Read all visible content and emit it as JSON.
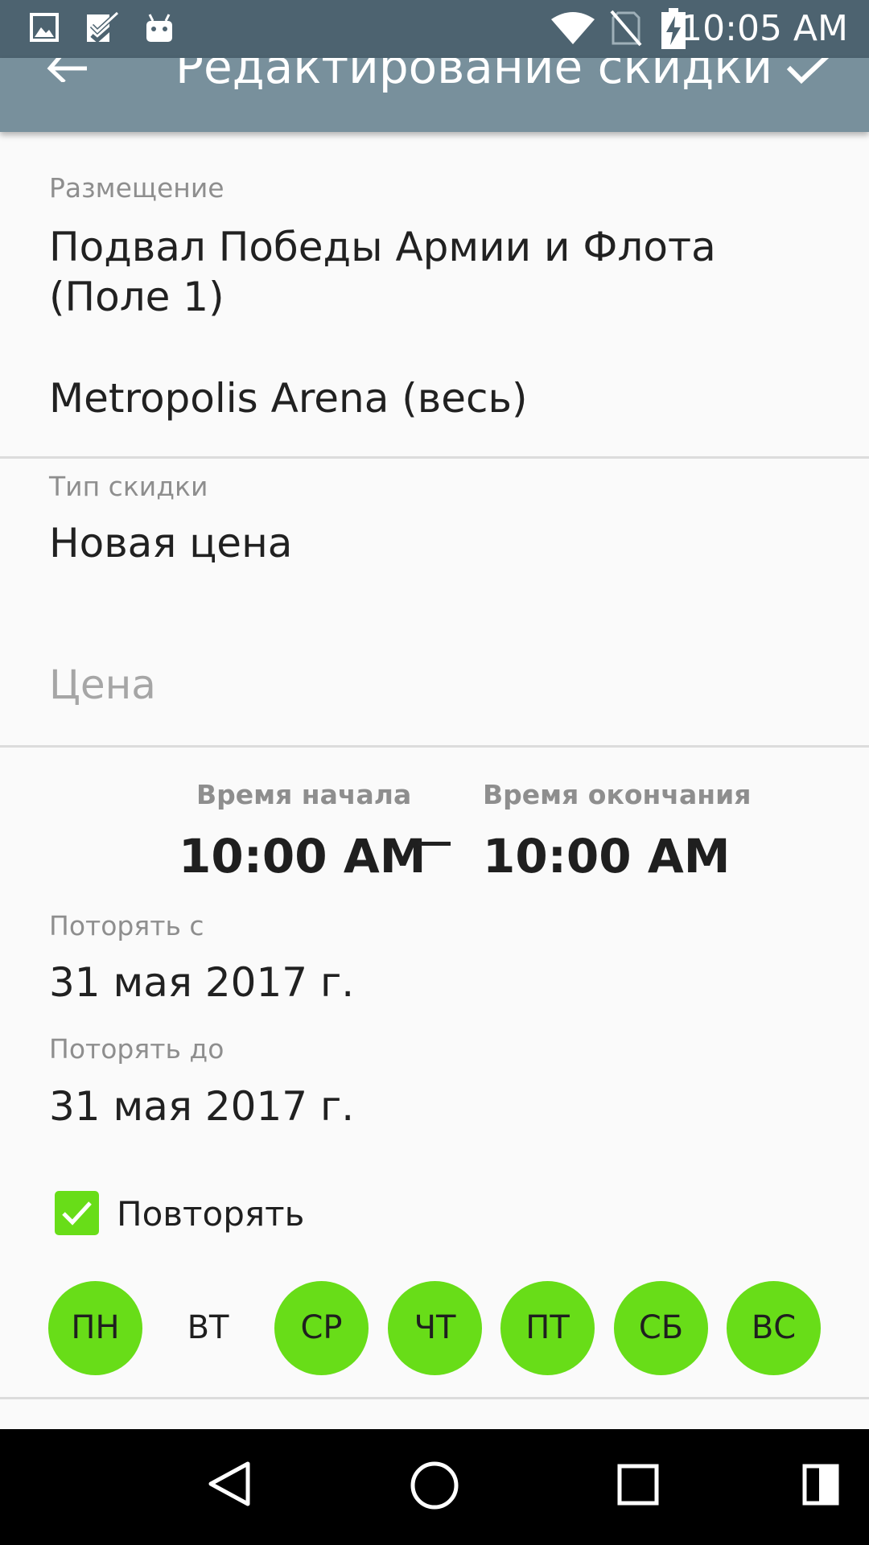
{
  "status_bar": {
    "time": "10:05 AM",
    "left_icons": [
      "image-icon",
      "checklist-icon",
      "android-icon"
    ],
    "right_icons": [
      "wifi-icon",
      "no-sim-icon",
      "battery-charging-icon"
    ]
  },
  "toolbar": {
    "title": "Редактирование скидки",
    "back_icon": "arrow-back-icon",
    "save_icon": "check-icon"
  },
  "placement": {
    "label": "Размещение",
    "options": [
      "Подвал Победы Армии и Флота",
      "(Поле 1)",
      "Metropolis Arena (весь)"
    ]
  },
  "discount_type": {
    "label": "Тип скидки",
    "value": "Новая цена"
  },
  "price": {
    "placeholder": "Цена",
    "value": ""
  },
  "time_range": {
    "start_label": "Время начала",
    "start_value": "10:00 AM",
    "end_label": "Время окончания",
    "end_value": "10:00 AM"
  },
  "repeat_from": {
    "label": "Поторять с",
    "value": "31 мая 2017 г."
  },
  "repeat_until": {
    "label": "Поторять до",
    "value": "31 мая 2017 г."
  },
  "repeat": {
    "label": "Повторять",
    "checked": true
  },
  "weekdays": [
    {
      "label": "ПН",
      "selected": true
    },
    {
      "label": "ВТ",
      "selected": false
    },
    {
      "label": "СР",
      "selected": true
    },
    {
      "label": "ЧТ",
      "selected": true
    },
    {
      "label": "ПТ",
      "selected": true
    },
    {
      "label": "СБ",
      "selected": true
    },
    {
      "label": "ВС",
      "selected": true
    }
  ],
  "colors": {
    "status_bar": "#4d6370",
    "toolbar": "#78909c",
    "accent": "#68dd18",
    "background": "#fafafa"
  },
  "nav_bar": {
    "icons": [
      "back-triangle-icon",
      "home-circle-icon",
      "recents-square-icon",
      "split-screen-icon"
    ]
  }
}
